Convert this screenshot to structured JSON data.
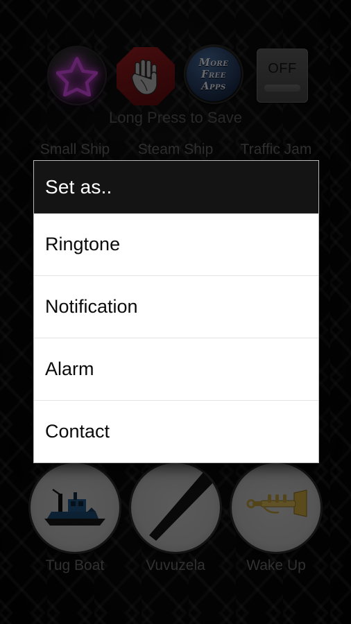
{
  "toolbar": {
    "favorites_label": "favorites-star",
    "stop_label": "stop-hand",
    "more_apps_line1": "More",
    "more_apps_line2": "Free",
    "more_apps_line3": "Apps",
    "toggle_label": "OFF"
  },
  "hint": {
    "text": "Long Press to Save"
  },
  "grid": {
    "row1": [
      {
        "label": "Small Ship",
        "icon": "small-ship-icon"
      },
      {
        "label": "Steam Ship",
        "icon": "steam-ship-icon"
      },
      {
        "label": "Traffic Jam",
        "icon": "traffic-jam-icon"
      }
    ],
    "row3": [
      {
        "label": "Tug Boat",
        "icon": "tug-boat-icon"
      },
      {
        "label": "Vuvuzela",
        "icon": "vuvuzela-icon"
      },
      {
        "label": "Wake Up",
        "icon": "trumpet-icon"
      }
    ]
  },
  "dialog": {
    "title": "Set as..",
    "options": [
      {
        "label": "Ringtone"
      },
      {
        "label": "Notification"
      },
      {
        "label": "Alarm"
      },
      {
        "label": "Contact"
      }
    ]
  },
  "colors": {
    "background": "#090909",
    "star_accent": "#c94be0",
    "stop_red": "#8c1a1d",
    "apps_blue": "#2f4a72",
    "dialog_bg": "#ffffff",
    "dialog_header_bg": "#050505",
    "label_text": "#6b6b6b",
    "hint_text": "#5a5a5a"
  }
}
